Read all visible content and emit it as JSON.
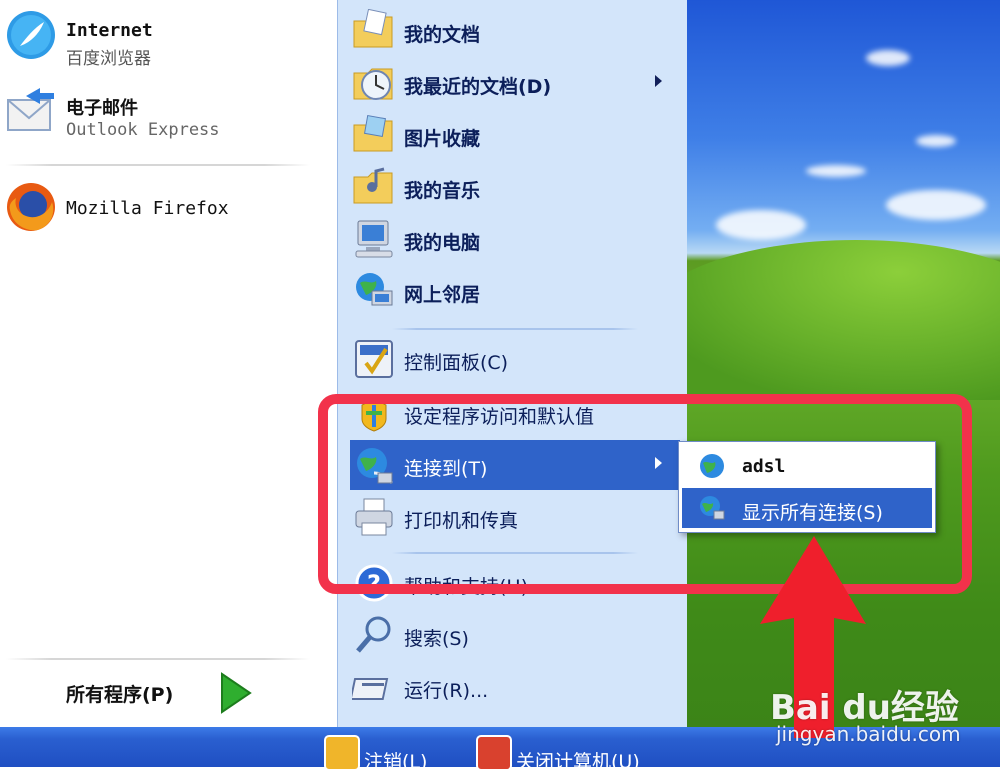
{
  "pinned": [
    {
      "title": "Internet",
      "subtitle": "百度浏览器",
      "icon": "browser-icon"
    },
    {
      "title": "电子邮件",
      "subtitle": "Outlook Express",
      "icon": "email-icon"
    },
    {
      "title": "Mozilla Firefox",
      "subtitle": "",
      "icon": "firefox-icon"
    }
  ],
  "all_programs": "所有程序(P)",
  "places": [
    {
      "label": "我的文档",
      "icon": "folder-documents-icon"
    },
    {
      "label": "我最近的文档(D)",
      "icon": "recent-documents-icon"
    },
    {
      "label": "图片收藏",
      "icon": "folder-pictures-icon"
    },
    {
      "label": "我的音乐",
      "icon": "folder-music-icon"
    },
    {
      "label": "我的电脑",
      "icon": "computer-icon"
    },
    {
      "label": "网上邻居",
      "icon": "network-places-icon"
    },
    {
      "label": "控制面板(C)",
      "icon": "control-panel-icon"
    },
    {
      "label": "设定程序访问和默认值",
      "icon": "program-access-icon"
    },
    {
      "label": "连接到(T)",
      "icon": "connect-to-icon"
    },
    {
      "label": "打印机和传真",
      "icon": "printer-icon"
    },
    {
      "label": "帮助和支持(H)",
      "icon": "help-icon"
    },
    {
      "label": "搜索(S)",
      "icon": "search-icon"
    },
    {
      "label": "运行(R)...",
      "icon": "run-icon"
    }
  ],
  "submenu": [
    {
      "label": "adsl",
      "icon": "globe-icon"
    },
    {
      "label": "显示所有连接(S)",
      "icon": "network-connections-icon"
    }
  ],
  "taskbar": {
    "logoff": "注销(L)",
    "shutdown": "关闭计算机(U)"
  },
  "watermark": {
    "logo": "Bai du经验",
    "url": "jingyan.baidu.com"
  },
  "colors": {
    "menu_right_bg": "#d3e5fa",
    "selection": "#2f63c9",
    "taskbar": "#2a5fd0",
    "annotation": "#f2324b"
  }
}
